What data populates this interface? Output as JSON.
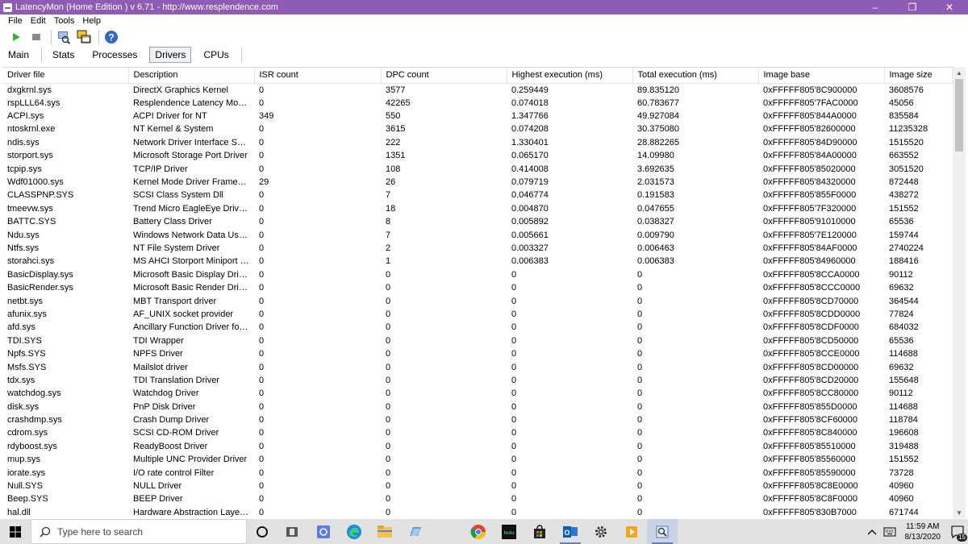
{
  "window": {
    "title": "LatencyMon  (Home Edition )  v 6.71 - http://www.resplendence.com",
    "controls": [
      "–",
      "❐",
      "✕"
    ]
  },
  "menu": [
    "File",
    "Edit",
    "Tools",
    "Help"
  ],
  "toolbar_icons": [
    "play-icon",
    "stop-icon",
    "search-process-icon",
    "windows-icon",
    "help-icon"
  ],
  "tabs": [
    "Main",
    "Stats",
    "Processes",
    "Drivers",
    "CPUs"
  ],
  "active_tab": "Drivers",
  "table": {
    "columns": [
      "Driver file",
      "Description",
      "ISR count",
      "DPC count",
      "Highest execution (ms)",
      "Total execution (ms)",
      "Image base",
      "Image size"
    ],
    "rows": [
      [
        "dxgkrnl.sys",
        "DirectX Graphics Kernel",
        "0",
        "3577",
        "0.259449",
        "89.835120",
        "0xFFFFF805'8C900000",
        "3608576"
      ],
      [
        "rspLLL64.sys",
        "Resplendence Latency Monit...",
        "0",
        "42265",
        "0.074018",
        "60.783677",
        "0xFFFFF805'7FAC0000",
        "45056"
      ],
      [
        "ACPI.sys",
        "ACPI Driver for NT",
        "349",
        "550",
        "1.347766",
        "49.927084",
        "0xFFFFF805'844A0000",
        "835584"
      ],
      [
        "ntoskrnl.exe",
        "NT Kernel & System",
        "0",
        "3615",
        "0.074208",
        "30.375080",
        "0xFFFFF805'82600000",
        "11235328"
      ],
      [
        "ndis.sys",
        "Network Driver Interface Sp...",
        "0",
        "222",
        "1.330401",
        "28.882265",
        "0xFFFFF805'84D90000",
        "1515520"
      ],
      [
        "storport.sys",
        "Microsoft Storage Port Driver",
        "0",
        "1351",
        "0.065170",
        "14.09980",
        "0xFFFFF805'84A00000",
        "663552"
      ],
      [
        "tcpip.sys",
        "TCP/IP Driver",
        "0",
        "108",
        "0.414008",
        "3.692635",
        "0xFFFFF805'85020000",
        "3051520"
      ],
      [
        "Wdf01000.sys",
        "Kernel Mode Driver Framew...",
        "29",
        "26",
        "0.079719",
        "2.031573",
        "0xFFFFF805'84320000",
        "872448"
      ],
      [
        "CLASSPNP.SYS",
        "SCSI Class System Dll",
        "0",
        "7",
        "0.046774",
        "0.191583",
        "0xFFFFF805'855F0000",
        "438272"
      ],
      [
        "tmeevw.sys",
        "Trend Micro EagleEye Driver...",
        "0",
        "18",
        "0.004870",
        "0.047655",
        "0xFFFFF805'7F320000",
        "151552"
      ],
      [
        "BATTC.SYS",
        "Battery Class Driver",
        "0",
        "8",
        "0.005892",
        "0.038327",
        "0xFFFFF805'91010000",
        "65536"
      ],
      [
        "Ndu.sys",
        "Windows Network Data Usa...",
        "0",
        "7",
        "0.005661",
        "0.009790",
        "0xFFFFF805'7E120000",
        "159744"
      ],
      [
        "Ntfs.sys",
        "NT File System Driver",
        "0",
        "2",
        "0.003327",
        "0.006463",
        "0xFFFFF805'84AF0000",
        "2740224"
      ],
      [
        "storahci.sys",
        "MS AHCI Storport Miniport D...",
        "0",
        "1",
        "0.006383",
        "0.006383",
        "0xFFFFF805'84960000",
        "188416"
      ],
      [
        "BasicDisplay.sys",
        "Microsoft Basic Display Driver",
        "0",
        "0",
        "0",
        "0",
        "0xFFFFF805'8CCA0000",
        "90112"
      ],
      [
        "BasicRender.sys",
        "Microsoft Basic Render Driver",
        "0",
        "0",
        "0",
        "0",
        "0xFFFFF805'8CCC0000",
        "69632"
      ],
      [
        "netbt.sys",
        "MBT Transport driver",
        "0",
        "0",
        "0",
        "0",
        "0xFFFFF805'8CD70000",
        "364544"
      ],
      [
        "afunix.sys",
        "AF_UNIX socket provider",
        "0",
        "0",
        "0",
        "0",
        "0xFFFFF805'8CDD0000",
        "77824"
      ],
      [
        "afd.sys",
        "Ancillary Function Driver for ...",
        "0",
        "0",
        "0",
        "0",
        "0xFFFFF805'8CDF0000",
        "684032"
      ],
      [
        "TDI.SYS",
        "TDI Wrapper",
        "0",
        "0",
        "0",
        "0",
        "0xFFFFF805'8CD50000",
        "65536"
      ],
      [
        "Npfs.SYS",
        "NPFS Driver",
        "0",
        "0",
        "0",
        "0",
        "0xFFFFF805'8CCE0000",
        "114688"
      ],
      [
        "Msfs.SYS",
        "Mailslot driver",
        "0",
        "0",
        "0",
        "0",
        "0xFFFFF805'8CD00000",
        "69632"
      ],
      [
        "tdx.sys",
        "TDI Translation Driver",
        "0",
        "0",
        "0",
        "0",
        "0xFFFFF805'8CD20000",
        "155648"
      ],
      [
        "watchdog.sys",
        "Watchdog Driver",
        "0",
        "0",
        "0",
        "0",
        "0xFFFFF805'8CC80000",
        "90112"
      ],
      [
        "disk.sys",
        "PnP Disk Driver",
        "0",
        "0",
        "0",
        "0",
        "0xFFFFF805'855D0000",
        "114688"
      ],
      [
        "crashdmp.sys",
        "Crash Dump Driver",
        "0",
        "0",
        "0",
        "0",
        "0xFFFFF805'8CF60000",
        "118784"
      ],
      [
        "cdrom.sys",
        "SCSI CD-ROM Driver",
        "0",
        "0",
        "0",
        "0",
        "0xFFFFF805'8C840000",
        "196608"
      ],
      [
        "rdyboost.sys",
        "ReadyBoost Driver",
        "0",
        "0",
        "0",
        "0",
        "0xFFFFF805'85510000",
        "319488"
      ],
      [
        "mup.sys",
        "Multiple UNC Provider Driver",
        "0",
        "0",
        "0",
        "0",
        "0xFFFFF805'85560000",
        "151552"
      ],
      [
        "iorate.sys",
        "I/O rate control Filter",
        "0",
        "0",
        "0",
        "0",
        "0xFFFFF805'85590000",
        "73728"
      ],
      [
        "Null.SYS",
        "NULL Driver",
        "0",
        "0",
        "0",
        "0",
        "0xFFFFF805'8C8E0000",
        "40960"
      ],
      [
        "Beep.SYS",
        "BEEP Driver",
        "0",
        "0",
        "0",
        "0",
        "0xFFFFF805'8C8F0000",
        "40960"
      ],
      [
        "hal.dll",
        "Hardware Abstraction Layer ...",
        "0",
        "0",
        "0",
        "0",
        "0xFFFFF805'830B7000",
        "671744"
      ]
    ]
  },
  "taskbar": {
    "search_placeholder": "Type here to search",
    "apps": [
      "cortana-icon",
      "task-view-icon",
      "app-icon",
      "edge-icon",
      "file-explorer-icon",
      "tablet-app-icon",
      "chrome-icon",
      "hulu-icon",
      "store-icon",
      "outlook-icon",
      "settings-icon",
      "media-icon",
      "latencymon-icon"
    ],
    "time": "11:59 AM",
    "date": "8/13/2020",
    "notification_count": "15"
  }
}
